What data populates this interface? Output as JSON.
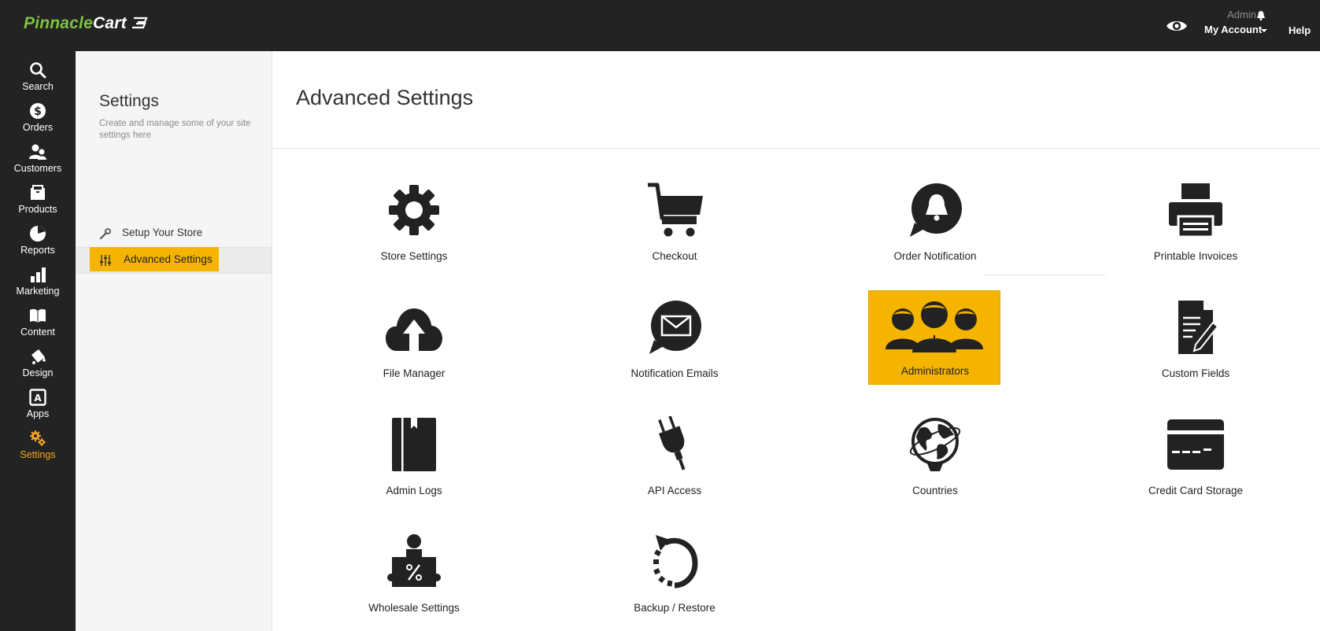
{
  "app": {
    "logo_part1": "Pinnacle",
    "logo_part2": "Cart",
    "admin_label": "Admin",
    "account_label": "My Account",
    "help_label": "Help"
  },
  "leftnav": [
    {
      "label": "Search",
      "icon": "search-icon"
    },
    {
      "label": "Orders",
      "icon": "dollar-icon"
    },
    {
      "label": "Customers",
      "icon": "users-icon"
    },
    {
      "label": "Products",
      "icon": "box-icon"
    },
    {
      "label": "Reports",
      "icon": "pie-chart-icon"
    },
    {
      "label": "Marketing",
      "icon": "bar-chart-icon"
    },
    {
      "label": "Content",
      "icon": "book-icon"
    },
    {
      "label": "Design",
      "icon": "paint-bucket-icon"
    },
    {
      "label": "Apps",
      "icon": "apps-icon"
    },
    {
      "label": "Settings",
      "icon": "gears-icon",
      "active": true
    }
  ],
  "subnav": {
    "title": "Settings",
    "description": "Create and manage some of your site settings here",
    "items": [
      {
        "label": "Setup Your Store",
        "icon": "wrench-icon"
      },
      {
        "label": "Advanced Settings",
        "icon": "sliders-icon",
        "active": true
      }
    ]
  },
  "page": {
    "title": "Advanced Settings"
  },
  "tiles": [
    {
      "label": "Store Settings",
      "icon": "gear-icon"
    },
    {
      "label": "Checkout",
      "icon": "cart-icon"
    },
    {
      "label": "Order Notification",
      "icon": "bell-bubble-icon"
    },
    {
      "label": "Printable Invoices",
      "icon": "printer-icon"
    },
    {
      "label": "File Manager",
      "icon": "cloud-upload-icon"
    },
    {
      "label": "Notification Emails",
      "icon": "envelope-bubble-icon"
    },
    {
      "label": "Administrators",
      "icon": "administrators-icon",
      "active": true
    },
    {
      "label": "Custom Fields",
      "icon": "document-edit-icon"
    },
    {
      "label": "Admin Logs",
      "icon": "logbook-icon"
    },
    {
      "label": "API Access",
      "icon": "plug-icon"
    },
    {
      "label": "Countries",
      "icon": "globe-icon"
    },
    {
      "label": "Credit Card Storage",
      "icon": "credit-card-icon"
    },
    {
      "label": "Wholesale Settings",
      "icon": "wholesale-icon"
    },
    {
      "label": "Backup / Restore",
      "icon": "backup-restore-icon"
    }
  ],
  "colors": {
    "topbar": "#232323",
    "brand_green": "#7dc242",
    "accent_yellow": "#f5b400",
    "active_orange": "#f5a623"
  }
}
